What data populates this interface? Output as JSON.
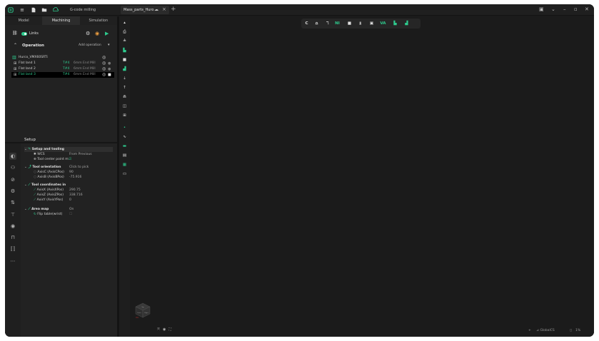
{
  "titlebar": {
    "project_name": "G-code milling",
    "document_tab": "Mass_parts_Huro",
    "add_tab": "+",
    "window_controls": {
      "minimize": "–",
      "maximize": "▫",
      "close": "✕"
    }
  },
  "mode_tabs": [
    "Model",
    "Machining",
    "Simulation"
  ],
  "active_mode_tab": "Machining",
  "links_label": "Links",
  "operation": {
    "title": "Operation",
    "add_label": "Add operation"
  },
  "tree": {
    "machine": "Hurco_VMX60SRTi",
    "ops": [
      {
        "name": "Flat land 1",
        "tool": "T#4",
        "desc": "6mm End Mill"
      },
      {
        "name": "Flat land 2",
        "tool": "T#4",
        "desc": "6mm End Mill"
      },
      {
        "name": "Flat land 3",
        "tool": "T#4",
        "desc": "6mm End Mill"
      }
    ]
  },
  "setup": {
    "title": "Setup",
    "groups": {
      "setup_tooling": "Setup and tooling",
      "wcs_label": "WCS",
      "wcs_value": "From Previous",
      "tcp_label": "Tool center point m",
      "tool_orientation": "Tool orientation",
      "tool_orientation_value": "Click to pick",
      "axisc_label": "AxisC (AxisCPos)",
      "axisc_value": "90",
      "axisb_label": "AxisB (AxisBPos)",
      "axisb_value": "-75.916",
      "tool_coords": "Tool coordinates in",
      "axisx_label": "AxisX (AxisXPos)",
      "axisx_value": "290.75",
      "axisz_label": "AxisZ (AxisZPos)",
      "axisz_value": "338.716",
      "axisy_label": "AxisY (AxisYPos)",
      "axisy_value": "0",
      "area_map": "Area map",
      "area_map_value": "On",
      "flip_label": "Flip table(wrist)"
    }
  },
  "viewport_toolbar": [
    "C",
    "NI",
    "VA"
  ],
  "navcube": {
    "top": "Top",
    "front": "Front",
    "right": "Right"
  },
  "status": {
    "cs": "GlobalCS",
    "zoom": "1%"
  },
  "colors": {
    "accent": "#2ecb8e",
    "background": "#1b1b1b",
    "panel": "#222222"
  }
}
